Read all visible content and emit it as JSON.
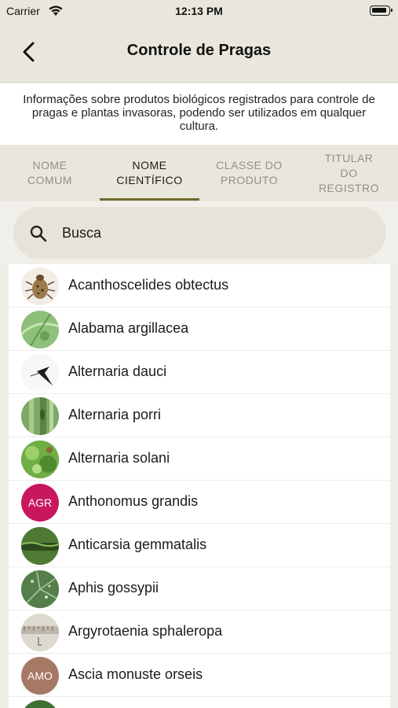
{
  "status": {
    "carrier": "Carrier",
    "time": "12:13 PM"
  },
  "nav": {
    "title": "Controle de Pragas",
    "back_icon": "chevron-left-icon"
  },
  "description": "Informações sobre produtos biológicos registrados para controle de pragas e plantas invasoras, podendo ser utilizados em qualquer cultura.",
  "tabs": [
    {
      "line1": "NOME",
      "line2": "COMUM",
      "line3": ""
    },
    {
      "line1": "NOME",
      "line2": "CIENTÍFICO",
      "line3": ""
    },
    {
      "line1": "CLASSE DO",
      "line2": "PRODUTO",
      "line3": ""
    },
    {
      "line1": "TITULAR",
      "line2": "DO",
      "line3": "REGISTRO"
    }
  ],
  "active_tab": 1,
  "search": {
    "placeholder": "Busca",
    "value": ""
  },
  "items": [
    {
      "label": "Acanthoscelides obtectus",
      "thumb": "photo-beetle",
      "initials": ""
    },
    {
      "label": "Alabama argillacea",
      "thumb": "photo-leaf",
      "initials": ""
    },
    {
      "label": "Alternaria dauci",
      "thumb": "photo-spore",
      "initials": ""
    },
    {
      "label": "Alternaria porri",
      "thumb": "photo-stem",
      "initials": ""
    },
    {
      "label": "Alternaria solani",
      "thumb": "photo-plant",
      "initials": ""
    },
    {
      "label": "Anthonomus grandis",
      "thumb": "initials",
      "initials": "AGR"
    },
    {
      "label": "Anticarsia gemmatalis",
      "thumb": "photo-caterpillar",
      "initials": ""
    },
    {
      "label": "Aphis gossypii",
      "thumb": "photo-aphid-leaf",
      "initials": ""
    },
    {
      "label": "Argyrotaenia sphaleropa",
      "thumb": "photo-ruler",
      "initials": ""
    },
    {
      "label": "Ascia monuste orseis",
      "thumb": "initials",
      "initials": "AMO"
    },
    {
      "label": "",
      "thumb": "photo-partial",
      "initials": ""
    }
  ],
  "colors": {
    "accent": "#6e6a2d",
    "agr_badge": "#c8175d",
    "amo_badge": "#a67866",
    "header_bg": "#e9e7dc"
  }
}
